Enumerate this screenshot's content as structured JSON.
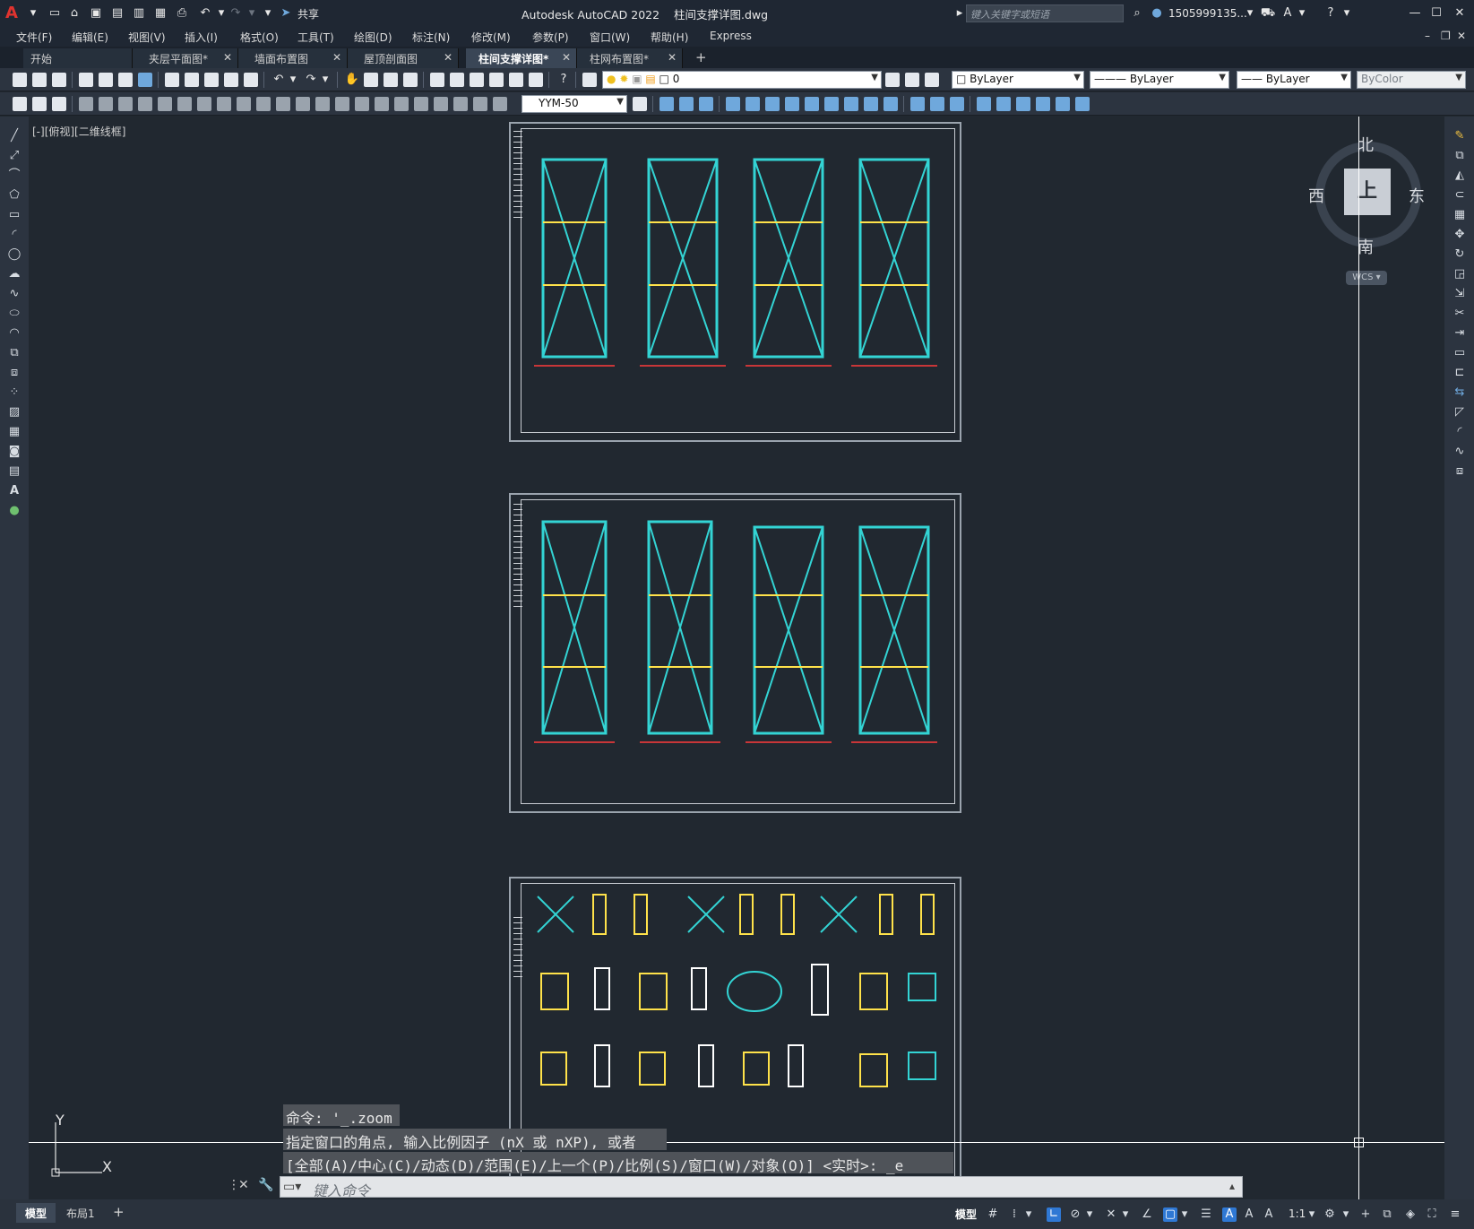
{
  "title_bar": {
    "app_title": "Autodesk AutoCAD 2022",
    "file_name": "柱间支撑详图.dwg",
    "share_label": "共享",
    "search_placeholder": "键入关键字或短语",
    "user_name": "1505999135..."
  },
  "menu": {
    "items": [
      "文件(F)",
      "编辑(E)",
      "视图(V)",
      "插入(I)",
      "格式(O)",
      "工具(T)",
      "绘图(D)",
      "标注(N)",
      "修改(M)",
      "参数(P)",
      "窗口(W)",
      "帮助(H)",
      "Express"
    ]
  },
  "tabs": [
    {
      "label": "开始",
      "closable": false,
      "active": false
    },
    {
      "label": "夹层平面图*",
      "closable": true,
      "active": false
    },
    {
      "label": "墙面布置图",
      "closable": true,
      "active": false
    },
    {
      "label": "屋顶剖面图",
      "closable": true,
      "active": false
    },
    {
      "label": "柱间支撑详图*",
      "closable": true,
      "active": true
    },
    {
      "label": "柱网布置图*",
      "closable": true,
      "active": false
    }
  ],
  "properties": {
    "layer": "0",
    "color": "ByLayer",
    "linetype": "ByLayer",
    "lineweight": "ByLayer",
    "plotstyle": "ByColor",
    "dimstyle": "YYM-50"
  },
  "viewport": {
    "label": "[-][俯视][二维线框]"
  },
  "viewcube": {
    "north": "北",
    "south": "南",
    "east": "东",
    "west": "西",
    "face": "上",
    "wcs": "WCS"
  },
  "ucs": {
    "x": "X",
    "y": "Y"
  },
  "command": {
    "history": [
      "命令: '_.zoom",
      "指定窗口的角点, 输入比例因子 (nX 或 nXP), 或者",
      "[全部(A)/中心(C)/动态(D)/范围(E)/上一个(P)/比例(S)/窗口(W)/对象(O)] <实时>: _e"
    ],
    "placeholder": "键入命令"
  },
  "status": {
    "layout_tabs": [
      "模型",
      "布局1"
    ],
    "model_label": "模型",
    "scale": "1:1"
  },
  "colors": {
    "background": "#212830",
    "toolbar": "#2c3440",
    "accent_tab": "#3a4656",
    "brand_red": "#e0332f",
    "drawing_cyan": "#33d4d4",
    "drawing_red": "#ff3b3b",
    "drawing_yellow": "#ffe24a"
  }
}
